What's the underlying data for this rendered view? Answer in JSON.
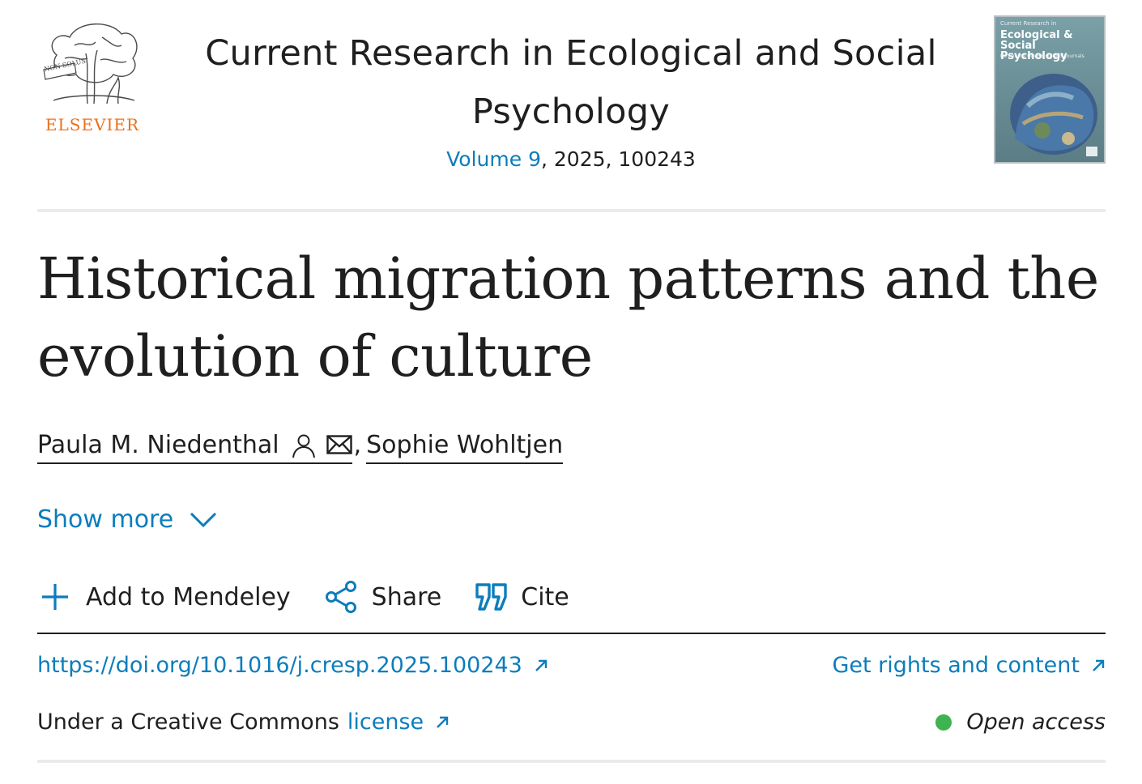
{
  "publisher": {
    "name": "ELSEVIER",
    "logo_motto": "NON SOLUS"
  },
  "journal": {
    "title": "Current Research in Ecological and Social Psychology",
    "volume_link": "Volume 9",
    "meta_rest": ", 2025, 100243",
    "cover": {
      "top_text": "Current Research in",
      "title": "Ecological & Social Psychology",
      "subtitle": "Part of the COnRE suite of journals"
    }
  },
  "article": {
    "title": "Historical migration patterns and the evolution of culture",
    "authors": [
      {
        "name": "Paula M. Niedenthal",
        "icons": [
          "person-icon",
          "envelope-icon"
        ]
      },
      {
        "name": "Sophie Wohltjen"
      }
    ],
    "author_separator": ","
  },
  "show_more": {
    "label": "Show more",
    "icon": "chevron-down-icon"
  },
  "toolbar": {
    "mendeley_label": "Add to Mendeley",
    "share_label": "Share",
    "cite_label": "Cite"
  },
  "links": {
    "doi": "https://doi.org/10.1016/j.cresp.2025.100243",
    "rights": "Get rights and content",
    "license_prefix": "Under a Creative Commons",
    "license_link": "license",
    "open_access": "Open access"
  },
  "colors": {
    "link": "#0c7dbb",
    "text": "#1f1f1f",
    "brand": "#e9711c",
    "open_access_dot": "#3fb34f"
  }
}
